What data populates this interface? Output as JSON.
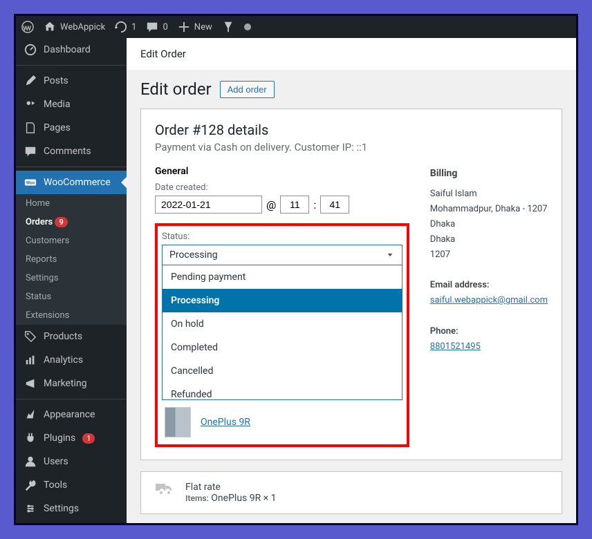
{
  "adminbar": {
    "site": "WebAppick",
    "updates": "1",
    "comments": "0",
    "new": "New"
  },
  "sidebar": {
    "dashboard": "Dashboard",
    "posts": "Posts",
    "media": "Media",
    "pages": "Pages",
    "comments": "Comments",
    "woocommerce": "WooCommerce",
    "sub": {
      "home": "Home",
      "orders": "Orders",
      "orders_badge": "9",
      "customers": "Customers",
      "reports": "Reports",
      "settings": "Settings",
      "status": "Status",
      "extensions": "Extensions"
    },
    "products": "Products",
    "analytics": "Analytics",
    "marketing": "Marketing",
    "appearance": "Appearance",
    "plugins": "Plugins",
    "plugins_badge": "1",
    "users": "Users",
    "tools": "Tools",
    "settings_main": "Settings"
  },
  "tab": "Edit Order",
  "page": {
    "title": "Edit order",
    "add": "Add order"
  },
  "order": {
    "title": "Order #128 details",
    "paytext": "Payment via Cash on delivery. Customer IP: ::1",
    "general_h": "General",
    "date_label": "Date created:",
    "date": "2022-01-21",
    "at": "@",
    "hour": "11",
    "sep": ":",
    "min": "41",
    "status_label": "Status:",
    "status_value": "Processing",
    "options": [
      "Pending payment",
      "Processing",
      "On hold",
      "Completed",
      "Cancelled",
      "Refunded"
    ],
    "product": "OnePlus 9R"
  },
  "billing": {
    "h": "Billing",
    "name": "Saiful Islam",
    "addr1": "Mohammadpur, Dhaka - 1207",
    "addr2": "Dhaka",
    "addr3": "Dhaka",
    "addr4": "1207",
    "email_l": "Email address:",
    "email": "saiful.webappick@gmail.com",
    "phone_l": "Phone:",
    "phone": "8801521495"
  },
  "ship": {
    "method": "Flat rate",
    "items_l": "Items:",
    "items": "OnePlus 9R × 1"
  }
}
